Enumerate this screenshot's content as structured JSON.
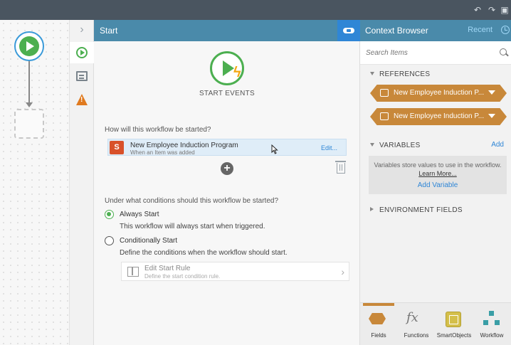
{
  "start_panel": {
    "title": "Start",
    "heading": "START EVENTS",
    "question_started": "How will this workflow be started?",
    "event": {
      "name": "New Employee Induction Program",
      "subtitle": "When an Item was added",
      "edit_label": "Edit...",
      "icon_letter": "S"
    },
    "question_conditions": "Under what conditions should this workflow be started?",
    "options": [
      {
        "label": "Always Start",
        "description": "This workflow will always start when triggered.",
        "selected": true
      },
      {
        "label": "Conditionally Start",
        "description": "Define the conditions when the workflow should start.",
        "selected": false
      }
    ],
    "start_rule": {
      "label": "Edit Start Rule",
      "subtitle": "Define the start condition rule."
    }
  },
  "context_browser": {
    "title": "Context Browser",
    "recent_label": "Recent",
    "search_placeholder": "Search Items",
    "references_header": "REFERENCES",
    "references": [
      {
        "label": "New Employee Induction P..."
      },
      {
        "label": "New Employee Induction P..."
      }
    ],
    "variables_header": "VARIABLES",
    "variables_add": "Add",
    "variables_text": "Variables store values to use in the workflow.",
    "variables_learn_more": "Learn More...",
    "variables_add_variable": "Add Variable",
    "environment_header": "ENVIRONMENT FIELDS"
  },
  "toolbox": {
    "tools": [
      {
        "label": "Fields",
        "icon": "fields-icon",
        "active": true
      },
      {
        "label": "Functions",
        "icon": "functions-icon",
        "active": false
      },
      {
        "label": "SmartObjects",
        "icon": "smartobjects-icon",
        "active": false
      },
      {
        "label": "Workflow",
        "icon": "workflow-icon",
        "active": false
      }
    ]
  },
  "colors": {
    "header_blue": "#4a8aaa",
    "accent_blue": "#2f86d6",
    "start_green": "#4caf50",
    "reference_orange": "#c8883a",
    "warning_orange": "#e07a1f",
    "sharepoint_red": "#d8512a"
  }
}
